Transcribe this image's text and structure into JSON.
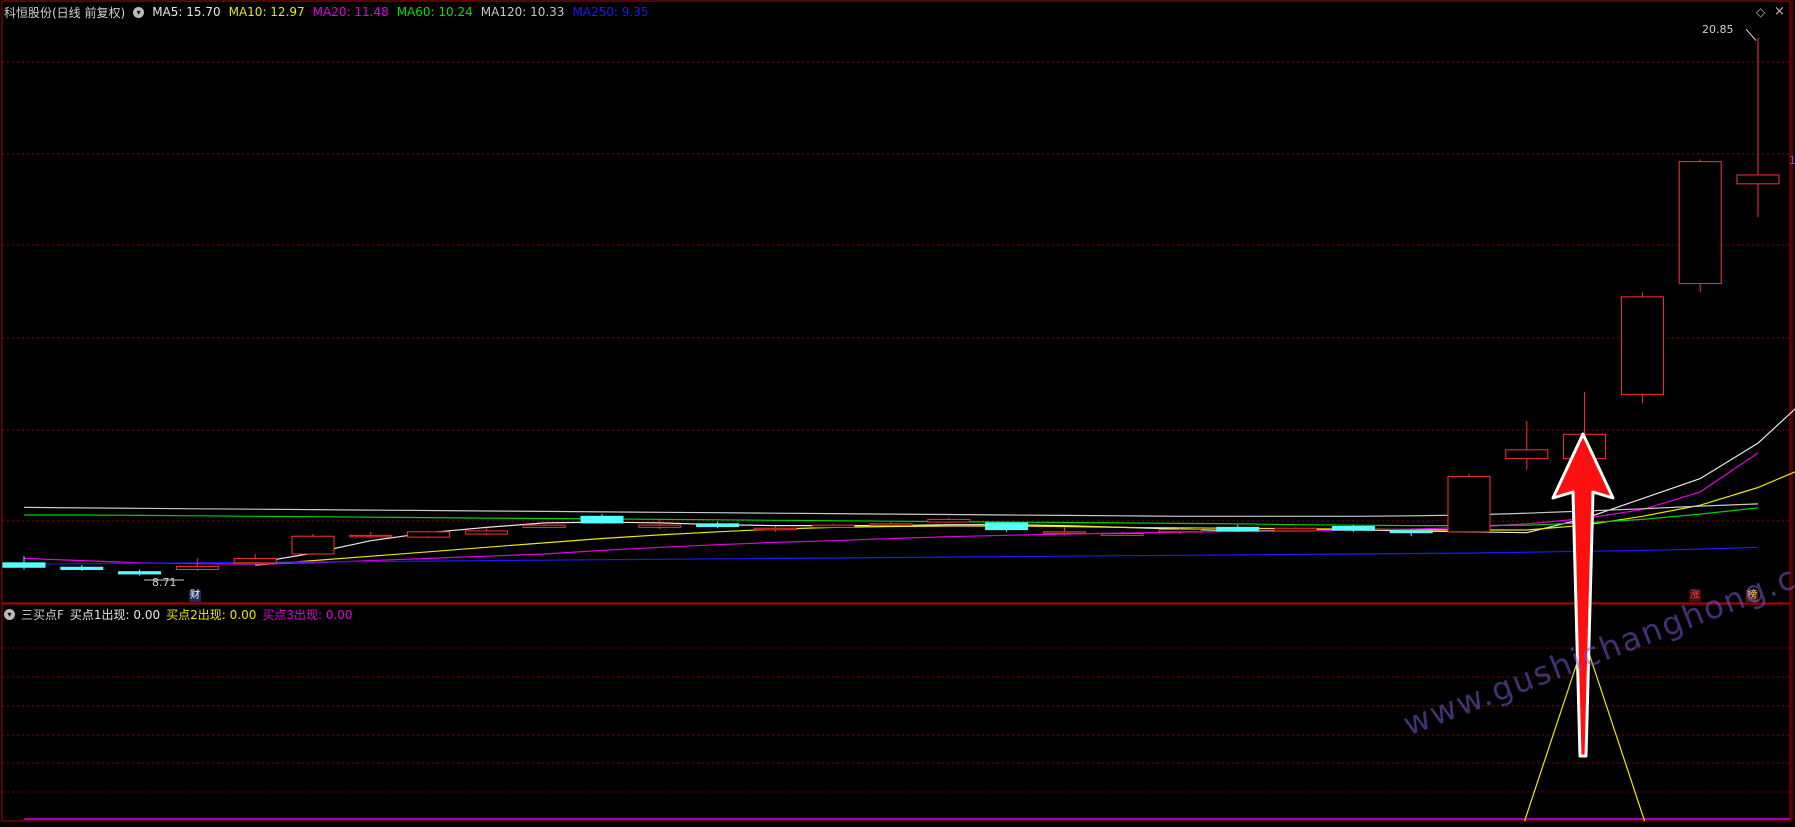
{
  "header": {
    "stock_title": "科恒股份(日线 前复权)",
    "ma_items": [
      {
        "label": "MA5: 15.70",
        "color": "#e6e6e6"
      },
      {
        "label": "MA10: 12.97",
        "color": "#e8e800"
      },
      {
        "label": "MA20: 11.48",
        "color": "#e000e0"
      },
      {
        "label": "MA60: 10.24",
        "color": "#00e000"
      },
      {
        "label": "MA120: 10.33",
        "color": "#c8c8c8"
      },
      {
        "label": "MA250: 9.35",
        "color": "#1a1aff"
      }
    ]
  },
  "indicator": {
    "title": "三买点F",
    "items": [
      {
        "label": "买点1出现: 0.00",
        "color": "#e6e6e6"
      },
      {
        "label": "买点2出现: 0.00",
        "color": "#e8e800"
      },
      {
        "label": "买点3出现: 0.00",
        "color": "#e000e0"
      }
    ],
    "spike": {
      "label": "买点2出现",
      "peak_value": 1.0,
      "at_candle": 27
    }
  },
  "annotations": {
    "max_price_label": "20.85",
    "min_price_label": "8.71",
    "right_edge_label": "1",
    "badge_cai": "财",
    "badge_zhang": "涨",
    "badge_bang": "榜"
  },
  "watermark": "www.gushichanghong.com",
  "colors": {
    "up": "#ff3232",
    "down": "#54ffff",
    "grid": "#8b0000",
    "border": "#b40000",
    "ma5": "#e6e6e6",
    "ma10": "#e8e800",
    "ma20": "#e000e0",
    "ma60": "#00d000",
    "ma120": "#c8c8c8",
    "ma250": "#1a1aff",
    "arrow": "#ff1010"
  },
  "chart_data": {
    "type": "candlestick",
    "price_range": [
      8.5,
      21.2
    ],
    "candles": [
      {
        "o": 9.0,
        "h": 9.15,
        "l": 8.85,
        "c": 8.9
      },
      {
        "o": 8.9,
        "h": 8.95,
        "l": 8.82,
        "c": 8.85
      },
      {
        "o": 8.8,
        "h": 8.85,
        "l": 8.71,
        "c": 8.75
      },
      {
        "o": 8.85,
        "h": 9.1,
        "l": 8.82,
        "c": 8.92
      },
      {
        "o": 9.0,
        "h": 9.2,
        "l": 8.98,
        "c": 9.1
      },
      {
        "o": 9.2,
        "h": 9.65,
        "l": 9.18,
        "c": 9.6
      },
      {
        "o": 9.6,
        "h": 9.7,
        "l": 9.55,
        "c": 9.62
      },
      {
        "o": 9.58,
        "h": 9.72,
        "l": 9.56,
        "c": 9.7
      },
      {
        "o": 9.65,
        "h": 9.78,
        "l": 9.62,
        "c": 9.72
      },
      {
        "o": 9.8,
        "h": 9.92,
        "l": 9.78,
        "c": 9.85
      },
      {
        "o": 10.05,
        "h": 10.1,
        "l": 9.88,
        "c": 9.9
      },
      {
        "o": 9.8,
        "h": 9.98,
        "l": 9.76,
        "c": 9.85
      },
      {
        "o": 9.88,
        "h": 9.93,
        "l": 9.78,
        "c": 9.82
      },
      {
        "o": 9.75,
        "h": 9.82,
        "l": 9.7,
        "c": 9.78
      },
      {
        "o": 9.8,
        "h": 9.88,
        "l": 9.78,
        "c": 9.85
      },
      {
        "o": 9.85,
        "h": 9.92,
        "l": 9.83,
        "c": 9.88
      },
      {
        "o": 9.92,
        "h": 10.02,
        "l": 9.9,
        "c": 9.98
      },
      {
        "o": 9.9,
        "h": 9.92,
        "l": 9.7,
        "c": 9.75
      },
      {
        "o": 9.7,
        "h": 9.8,
        "l": 9.62,
        "c": 9.7
      },
      {
        "o": 9.62,
        "h": 9.7,
        "l": 9.6,
        "c": 9.66
      },
      {
        "o": 9.7,
        "h": 9.8,
        "l": 9.65,
        "c": 9.75
      },
      {
        "o": 9.8,
        "h": 9.86,
        "l": 9.7,
        "c": 9.72
      },
      {
        "o": 9.72,
        "h": 9.8,
        "l": 9.7,
        "c": 9.78
      },
      {
        "o": 9.82,
        "h": 9.86,
        "l": 9.7,
        "c": 9.74
      },
      {
        "o": 9.72,
        "h": 9.75,
        "l": 9.6,
        "c": 9.68
      },
      {
        "o": 9.7,
        "h": 11.0,
        "l": 9.68,
        "c": 10.95
      },
      {
        "o": 11.35,
        "h": 12.2,
        "l": 11.1,
        "c": 11.55
      },
      {
        "o": 11.35,
        "h": 12.85,
        "l": 11.35,
        "c": 11.9
      },
      {
        "o": 12.8,
        "h": 15.1,
        "l": 12.6,
        "c": 15.0
      },
      {
        "o": 15.3,
        "h": 18.1,
        "l": 15.1,
        "c": 18.05
      },
      {
        "o": 17.55,
        "h": 20.85,
        "l": 16.8,
        "c": 17.75
      }
    ],
    "ma": {
      "ma5": {
        "start": 4,
        "values": [
          9.0,
          9.22,
          9.5,
          9.68,
          9.8,
          9.9,
          9.92,
          9.9,
          9.86,
          9.84,
          9.84,
          9.84,
          9.86,
          9.86,
          9.84,
          9.8,
          9.76,
          9.72,
          9.73,
          9.74,
          9.72,
          9.7,
          9.68,
          10.0,
          10.45,
          10.9,
          11.7,
          12.9,
          14.3,
          15.7
        ]
      },
      "ma10": {
        "start": 4,
        "values": [
          8.95,
          9.05,
          9.15,
          9.25,
          9.35,
          9.45,
          9.55,
          9.63,
          9.7,
          9.76,
          9.8,
          9.82,
          9.83,
          9.83,
          9.82,
          9.8,
          9.79,
          9.78,
          9.77,
          9.76,
          9.75,
          9.74,
          9.74,
          9.85,
          10.05,
          10.3,
          10.7,
          11.25,
          12.0,
          12.97
        ]
      },
      "ma20": {
        "start": 0,
        "values": [
          9.1,
          9.05,
          9.0,
          8.98,
          8.97,
          9.0,
          9.05,
          9.1,
          9.15,
          9.2,
          9.28,
          9.35,
          9.41,
          9.46,
          9.5,
          9.55,
          9.59,
          9.62,
          9.65,
          9.67,
          9.69,
          9.71,
          9.72,
          9.74,
          9.76,
          9.8,
          9.88,
          10.0,
          10.2,
          10.6,
          11.48
        ]
      },
      "ma60": {
        "start": 0,
        "values": [
          10.08,
          10.08,
          10.07,
          10.06,
          10.05,
          10.04,
          10.03,
          10.02,
          10.01,
          10.0,
          9.99,
          9.98,
          9.97,
          9.96,
          9.95,
          9.94,
          9.93,
          9.92,
          9.91,
          9.9,
          9.89,
          9.88,
          9.86,
          9.85,
          9.84,
          9.84,
          9.85,
          9.9,
          9.98,
          10.1,
          10.24
        ]
      },
      "ma120": {
        "start": 0,
        "values": [
          10.25,
          10.24,
          10.23,
          10.22,
          10.21,
          10.2,
          10.19,
          10.18,
          10.17,
          10.16,
          10.15,
          10.14,
          10.13,
          10.12,
          10.11,
          10.1,
          10.09,
          10.08,
          10.07,
          10.06,
          10.05,
          10.05,
          10.05,
          10.05,
          10.06,
          10.08,
          10.12,
          10.17,
          10.22,
          10.28,
          10.33
        ]
      },
      "ma250": {
        "start": 0,
        "values": [
          8.97,
          8.98,
          8.99,
          9.0,
          9.01,
          9.02,
          9.03,
          9.04,
          9.05,
          9.06,
          9.07,
          9.08,
          9.09,
          9.1,
          9.11,
          9.12,
          9.13,
          9.14,
          9.15,
          9.16,
          9.17,
          9.18,
          9.19,
          9.2,
          9.21,
          9.22,
          9.24,
          9.26,
          9.28,
          9.31,
          9.35
        ]
      }
    }
  }
}
